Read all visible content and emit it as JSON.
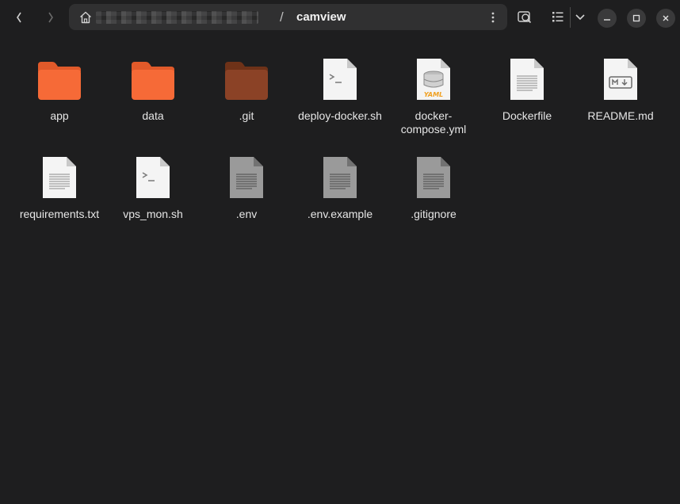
{
  "window": {
    "path_current": "camview",
    "path_separator": "/"
  },
  "colors": {
    "folder": "#f66a37",
    "folder_dark": "#e85a28",
    "git_folder": "#8b4226",
    "doc_light": "#f4f4f4",
    "doc_grey": "#9a9a9a",
    "yaml_accent": "#f0a020"
  },
  "files": [
    {
      "label": "app",
      "icon": "folder-icon"
    },
    {
      "label": "data",
      "icon": "folder-icon"
    },
    {
      "label": ".git",
      "icon": "git-folder-icon"
    },
    {
      "label": "deploy-docker.sh",
      "icon": "shell-script-icon"
    },
    {
      "label": "docker-compose.yml",
      "icon": "yaml-file-icon"
    },
    {
      "label": "Dockerfile",
      "icon": "text-file-icon"
    },
    {
      "label": "README.md",
      "icon": "markdown-file-icon"
    },
    {
      "label": "requirements.txt",
      "icon": "text-file-icon"
    },
    {
      "label": "vps_mon.sh",
      "icon": "shell-script-icon"
    },
    {
      "label": ".env",
      "icon": "hidden-file-icon"
    },
    {
      "label": ".env.example",
      "icon": "hidden-file-icon"
    },
    {
      "label": ".gitignore",
      "icon": "hidden-file-icon"
    }
  ]
}
